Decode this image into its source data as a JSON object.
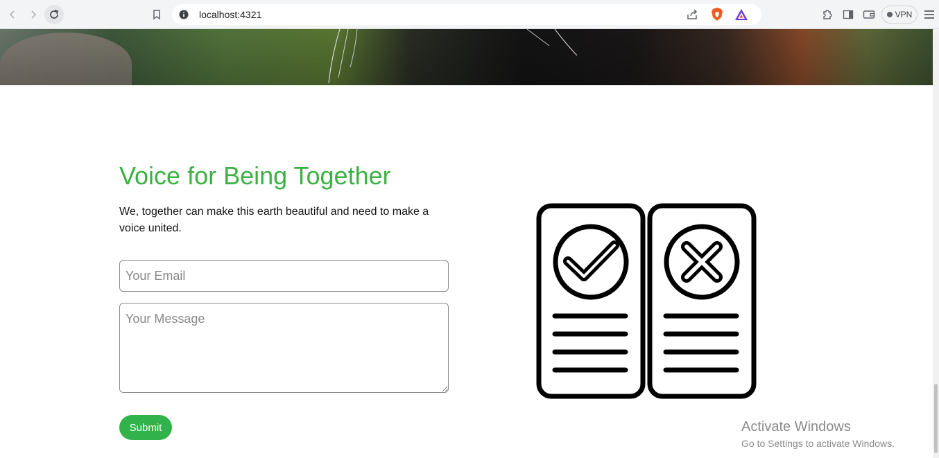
{
  "browser": {
    "url": "localhost:4321",
    "vpn_label": "VPN"
  },
  "icons": [
    "back-icon",
    "forward-icon",
    "reload-icon",
    "bookmark-icon",
    "site-info-icon",
    "share-icon",
    "brave-shields-icon",
    "brave-rewards-icon",
    "extensions-icon",
    "sidebar-icon",
    "wallet-icon",
    "menu-icon"
  ],
  "colors": {
    "accent": "#3cb043",
    "button": "#32b24a"
  },
  "section": {
    "title": "Voice for Being Together",
    "description": "We, together can make this earth beautiful and need to make a voice united."
  },
  "form": {
    "email_placeholder": "Your Email",
    "message_placeholder": "Your Message",
    "submit_label": "Submit"
  },
  "watermark": {
    "line1": "Activate Windows",
    "line2": "Go to Settings to activate Windows."
  }
}
